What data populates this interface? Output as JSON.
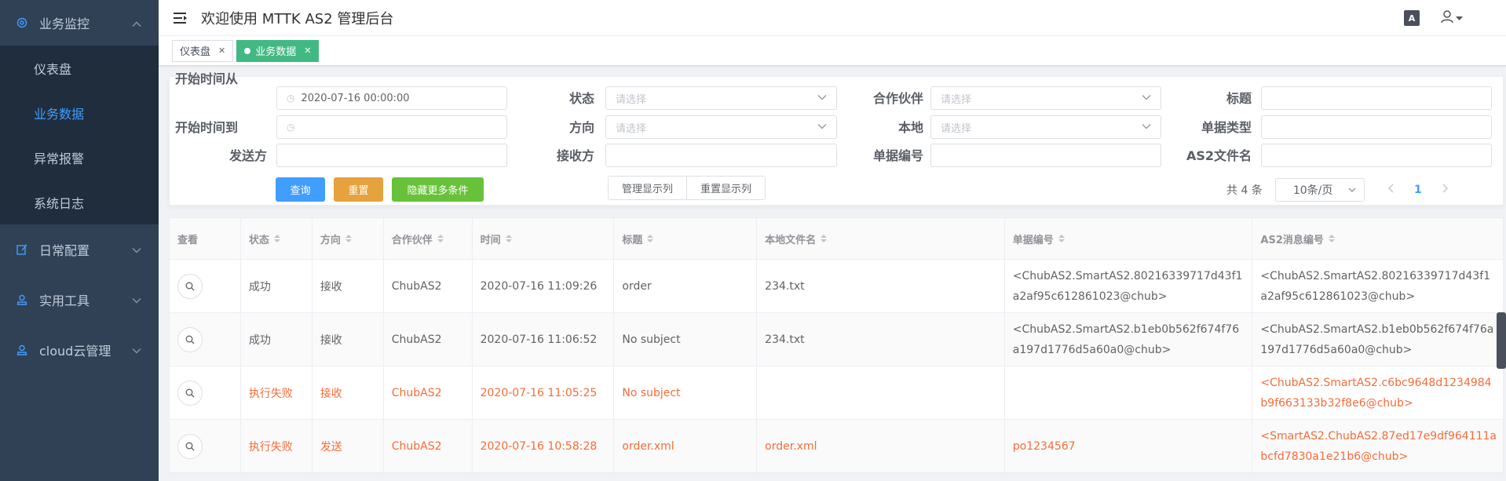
{
  "sidebar": {
    "groups": [
      {
        "label": "业务监控",
        "icon": "monitor-icon",
        "open": true,
        "items": [
          {
            "label": "仪表盘",
            "active": false
          },
          {
            "label": "业务数据",
            "active": true
          },
          {
            "label": "异常报警",
            "active": false
          },
          {
            "label": "系统日志",
            "active": false
          }
        ]
      },
      {
        "label": "日常配置",
        "icon": "edit-icon",
        "open": false
      },
      {
        "label": "实用工具",
        "icon": "user-icon",
        "open": false
      },
      {
        "label": "cloud云管理",
        "icon": "user-icon",
        "open": false
      }
    ]
  },
  "header": {
    "title": "欢迎使用 MTTK AS2 管理后台",
    "lang_glyph": "A"
  },
  "tags": [
    {
      "label": "仪表盘",
      "active": false
    },
    {
      "label": "业务数据",
      "active": true
    }
  ],
  "filter": {
    "labels": {
      "start_from": "开始时间从",
      "start_to": "开始时间到",
      "sender": "发送方",
      "status": "状态",
      "direction": "方向",
      "receiver": "接收方",
      "partner": "合作伙伴",
      "local": "本地",
      "doc_no": "单据编号",
      "title": "标题",
      "doc_type": "单据类型",
      "as2_filename": "AS2文件名"
    },
    "values": {
      "start_from": "2020-07-16 00:00:00",
      "start_to": "",
      "sender": "",
      "receiver": "",
      "doc_no": "",
      "title": "",
      "doc_type": "",
      "as2_filename": ""
    },
    "placeholder_select": "请选择",
    "buttons": {
      "query": "查询",
      "reset": "重置",
      "hide_more": "隐藏更多条件",
      "manage_cols": "管理显示列",
      "reset_cols": "重置显示列"
    },
    "pagination": {
      "total": "共 4 条",
      "page_size": "10条/页",
      "current_page": "1"
    }
  },
  "table": {
    "columns": [
      "查看",
      "状态",
      "方向",
      "合作伙伴",
      "时间",
      "标题",
      "本地文件名",
      "单据编号",
      "AS2消息编号"
    ],
    "sortable": [
      false,
      true,
      true,
      true,
      true,
      true,
      true,
      true,
      true
    ],
    "rows": [
      {
        "status": "成功",
        "direction": "接收",
        "partner": "ChubAS2",
        "time": "2020-07-16 11:09:26",
        "title": "order",
        "local_file": "234.txt",
        "doc_no": "<ChubAS2.SmartAS2.80216339717d43f1a2af95c612861023@chub>",
        "as2_msg": "<ChubAS2.SmartAS2.80216339717d43f1a2af95c612861023@chub>",
        "failed": false
      },
      {
        "status": "成功",
        "direction": "接收",
        "partner": "ChubAS2",
        "time": "2020-07-16 11:06:52",
        "title": "No subject",
        "local_file": "234.txt",
        "doc_no": "<ChubAS2.SmartAS2.b1eb0b562f674f76a197d1776d5a60a0@chub>",
        "as2_msg": "<ChubAS2.SmartAS2.b1eb0b562f674f76a197d1776d5a60a0@chub>",
        "failed": false
      },
      {
        "status": "执行失败",
        "direction": "接收",
        "partner": "ChubAS2",
        "time": "2020-07-16 11:05:25",
        "title": "No subject",
        "local_file": "",
        "doc_no": "",
        "as2_msg": "<ChubAS2.SmartAS2.c6bc9648d1234984b9f663133b32f8e6@chub>",
        "failed": true
      },
      {
        "status": "执行失败",
        "direction": "发送",
        "partner": "ChubAS2",
        "time": "2020-07-16 10:58:28",
        "title": "order.xml",
        "local_file": "order.xml",
        "doc_no": "po1234567",
        "as2_msg": "<SmartAS2.ChubAS2.87ed17e9df964111abcfd7830a1e21b6@chub>",
        "failed": true
      }
    ]
  },
  "colors": {
    "sidebar_bg": "#304156",
    "submenu_bg": "#1f2d3d",
    "accent": "#409eff",
    "tag_active": "#42b983",
    "fail_text": "#f56c39"
  }
}
